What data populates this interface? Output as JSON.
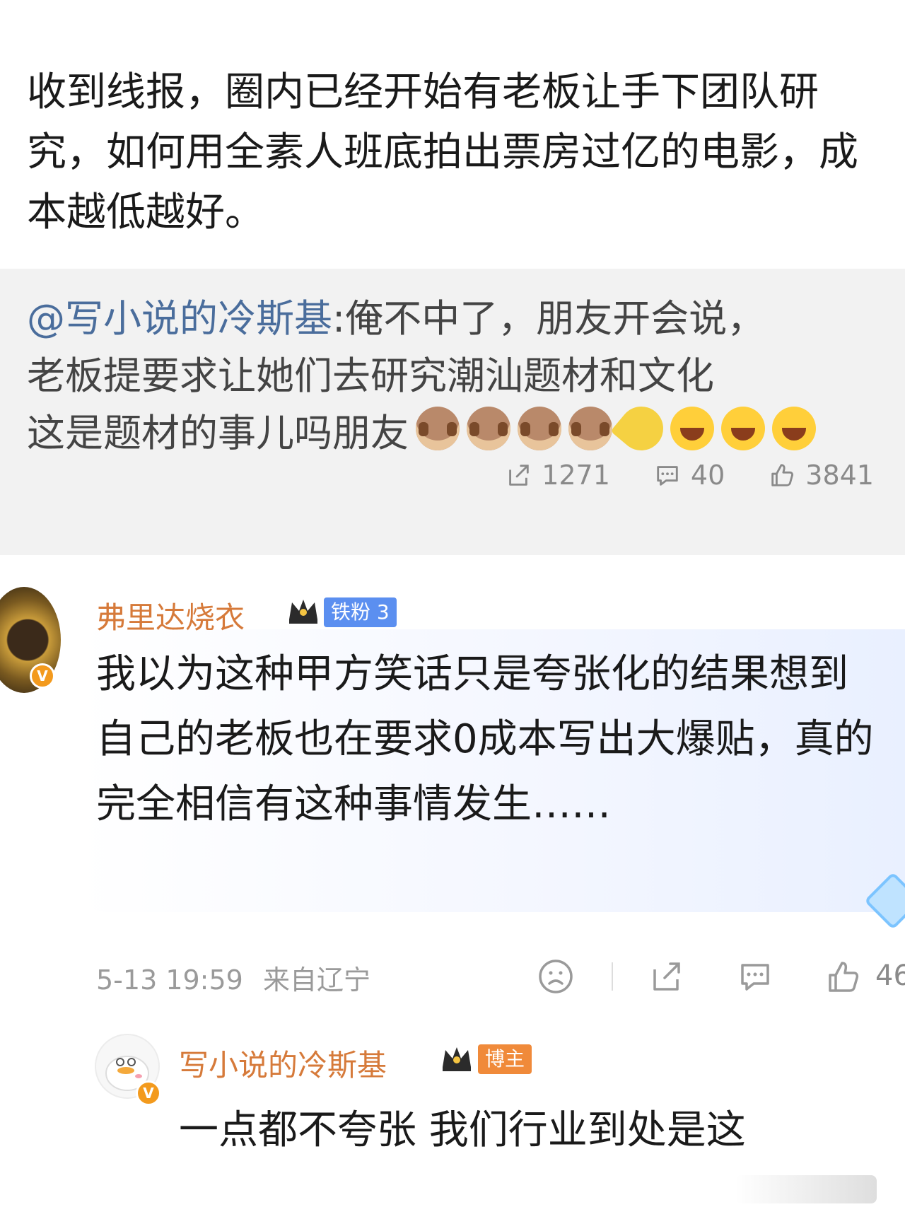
{
  "post": {
    "text": "收到线报，圈内已经开始有老板让手下团队研究，如何用全素人班底拍出票房过亿的电影，成本越低越好。"
  },
  "repost": {
    "mention": "@写小说的冷斯基",
    "line1_rest": ":俺不中了，朋友开会说，",
    "line2": "老板提要求让她们去研究潮汕题材和文化",
    "line3": "这是题材的事儿吗朋友",
    "emojis": [
      "monkey-see-no-evil",
      "monkey-see-no-evil",
      "monkey-see-no-evil",
      "monkey-see-no-evil",
      "lightbulb-broken",
      "laughing-tears",
      "laughing-tears",
      "laughing-tears"
    ],
    "stats": {
      "reposts": "1271",
      "comments": "40",
      "likes": "3841"
    }
  },
  "comment": {
    "username": "弗里达烧衣",
    "fan_badge": "铁粉 3",
    "text": "我以为这种甲方笑话只是夸张化的结果想到自己的老板也在要求0成本写出大爆贴，真的完全相信有这种事情发生……",
    "timestamp": "5-13 19:59",
    "location": "来自辽宁",
    "like_count": "46",
    "verified_label": "V"
  },
  "reply": {
    "username": "写小说的冷斯基",
    "badge": "博主",
    "text": "一点都不夸张 我们行业到处是这",
    "verified_label": "V"
  },
  "colors": {
    "username": "#d67a3a",
    "mention": "#4a6d9c",
    "fan_badge": "#5b8ff0",
    "blogger_badge": "#f08a3a",
    "verified": "#f39a1d"
  }
}
